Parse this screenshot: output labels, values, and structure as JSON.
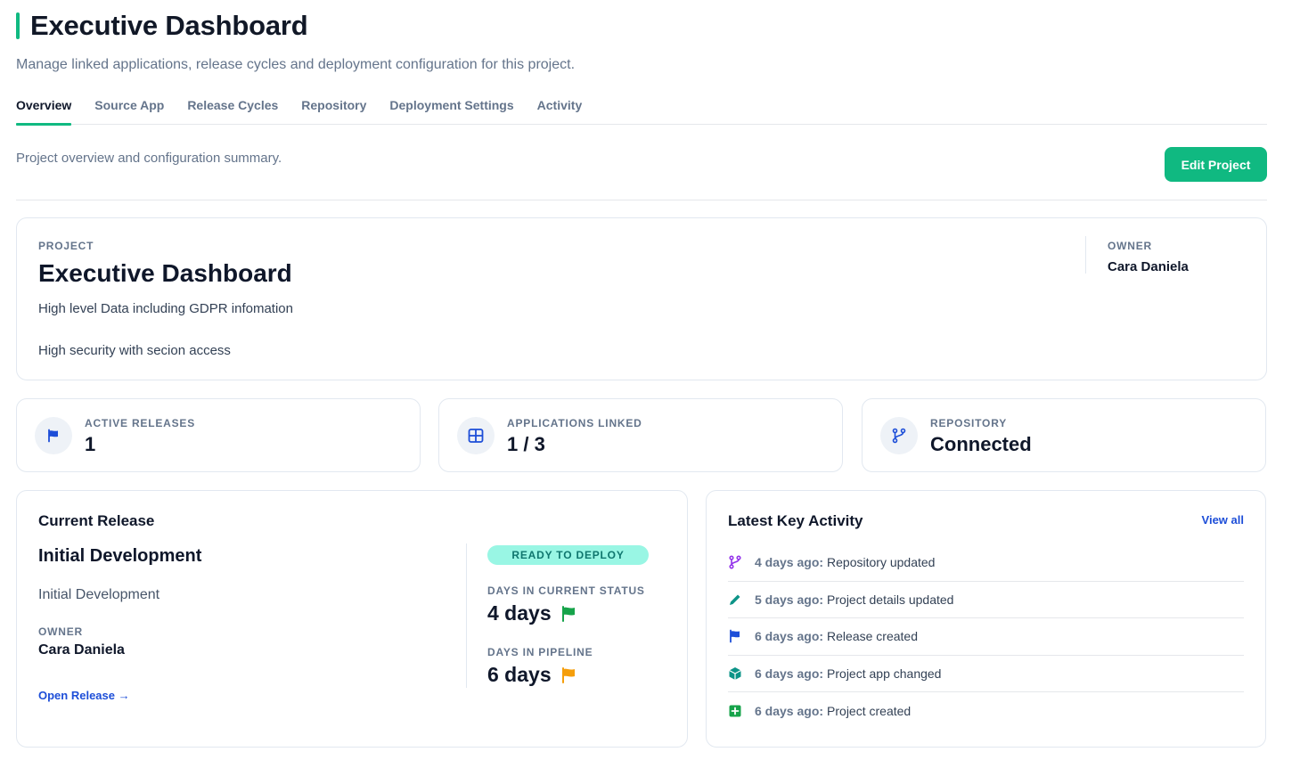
{
  "header": {
    "title": "Executive Dashboard",
    "subtitle": "Manage linked applications, release cycles and deployment configuration for this project."
  },
  "tabs": [
    {
      "label": "Overview",
      "active": true
    },
    {
      "label": "Source App",
      "active": false
    },
    {
      "label": "Release Cycles",
      "active": false
    },
    {
      "label": "Repository",
      "active": false
    },
    {
      "label": "Deployment Settings",
      "active": false
    },
    {
      "label": "Activity",
      "active": false
    }
  ],
  "section": {
    "description": "Project overview and configuration summary.",
    "edit_button": "Edit Project"
  },
  "project": {
    "eyebrow": "PROJECT",
    "name": "Executive Dashboard",
    "description_line1": "High level Data including GDPR infomation",
    "description_line2": "High security with secion access",
    "owner_label": "OWNER",
    "owner_name": "Cara Daniela"
  },
  "stats": [
    {
      "icon": "flag-icon",
      "label": "ACTIVE RELEASES",
      "value": "1"
    },
    {
      "icon": "grid-icon",
      "label": "APPLICATIONS LINKED",
      "value": "1 / 3"
    },
    {
      "icon": "git-branch-icon",
      "label": "REPOSITORY",
      "value": "Connected"
    }
  ],
  "current_release": {
    "title": "Current Release",
    "name": "Initial Development",
    "description": "Initial Development",
    "owner_label": "OWNER",
    "owner_name": "Cara Daniela",
    "open_link": "Open Release →",
    "status": "READY TO DEPLOY",
    "days_current_label": "DAYS IN CURRENT STATUS",
    "days_current_value": "4 days",
    "days_pipeline_label": "DAYS IN PIPELINE",
    "days_pipeline_value": "6 days"
  },
  "activity": {
    "title": "Latest Key Activity",
    "view_all": "View all",
    "items": [
      {
        "icon": "git-branch-icon",
        "time": "4 days ago:",
        "text": "Repository updated"
      },
      {
        "icon": "pencil-icon",
        "time": "5 days ago:",
        "text": "Project details updated"
      },
      {
        "icon": "flag-icon",
        "time": "6 days ago:",
        "text": "Release created"
      },
      {
        "icon": "box-icon",
        "time": "6 days ago:",
        "text": "Project app changed"
      },
      {
        "icon": "plus-square-icon",
        "time": "6 days ago:",
        "text": "Project created"
      }
    ]
  },
  "colors": {
    "accent": "#10b981",
    "link": "#1d4ed8",
    "badge_bg": "#99f6e4",
    "flag_green": "#16a34a",
    "flag_amber": "#f59e0b"
  }
}
